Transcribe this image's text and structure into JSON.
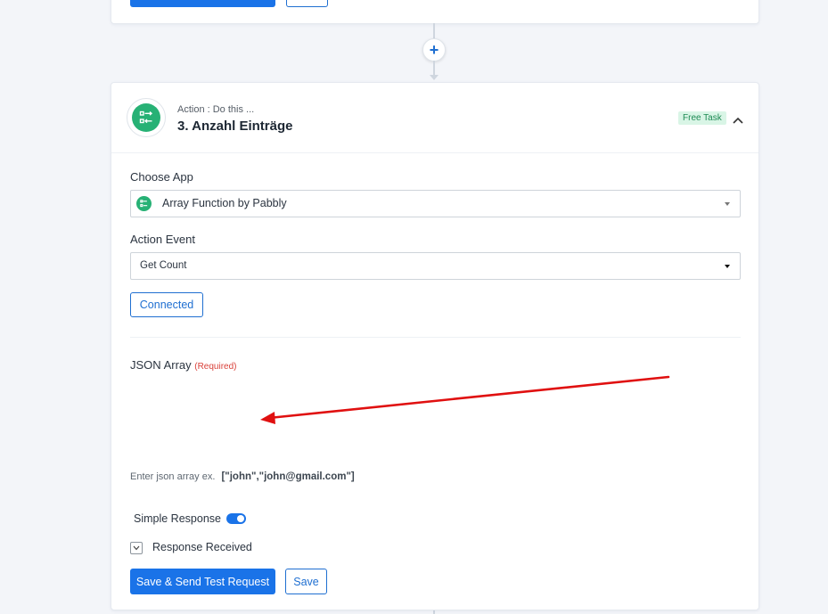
{
  "connector": {
    "add_label": "+"
  },
  "step": {
    "subtitle": "Action : Do this ...",
    "title": "3. Anzahl Einträge",
    "badge": "Free Task",
    "icon": "array-function-icon"
  },
  "form": {
    "choose_app_label": "Choose App",
    "app_value": "Array Function by Pabbly",
    "action_event_label": "Action Event",
    "action_event_value": "Get Count",
    "connected_label": "Connected",
    "json_array_label": "JSON Array",
    "required_label": "(Required)",
    "help_text": "Enter json array ex.",
    "help_example": "[\"john\",\"john@gmail.com\"]",
    "simple_response_label": "Simple Response",
    "simple_response_on": true,
    "response_received_label": "Response Received",
    "save_send_label": "Save & Send Test Request",
    "save_label": "Save"
  },
  "colors": {
    "primary": "#1a73e8",
    "app_green": "#27b175",
    "badge_bg": "#d9f5e6",
    "required_red": "#d9413a",
    "annotation_arrow": "#e01010"
  }
}
